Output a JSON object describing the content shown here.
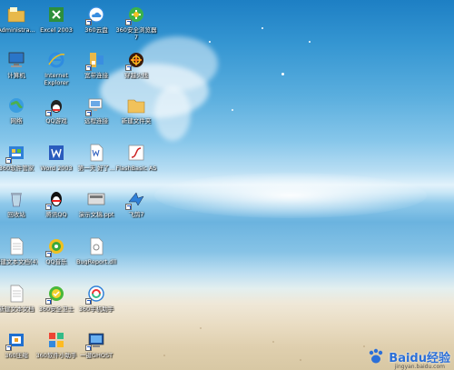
{
  "desktop": {
    "icons": [
      {
        "id": "admin",
        "label": "Administra..."
      },
      {
        "id": "excel",
        "label": "Excel 2003"
      },
      {
        "id": "cloud360",
        "label": "360云盘"
      },
      {
        "id": "browser360",
        "label": "360安全浏览器7"
      },
      {
        "id": "computer",
        "label": "计算机"
      },
      {
        "id": "ie",
        "label": "Internet Explorer"
      },
      {
        "id": "broadband",
        "label": "宽带连接"
      },
      {
        "id": "game",
        "label": "穿越火线"
      },
      {
        "id": "network",
        "label": "网络"
      },
      {
        "id": "qqgame",
        "label": "QQ游戏"
      },
      {
        "id": "remote",
        "label": "远程连接"
      },
      {
        "id": "newfolder",
        "label": "新建文件夹"
      },
      {
        "id": "soft360",
        "label": "360软件管家"
      },
      {
        "id": "word",
        "label": "Word 2003"
      },
      {
        "id": "doc1",
        "label": "第一天 好了..."
      },
      {
        "id": "flash",
        "label": "FlashBasic AS"
      },
      {
        "id": "recycle",
        "label": "回收站"
      },
      {
        "id": "tencentqq",
        "label": "腾讯QQ"
      },
      {
        "id": "ppt",
        "label": "演示文稿.ppt"
      },
      {
        "id": "feiq",
        "label": "飞鸽7"
      },
      {
        "id": "txt1",
        "label": "新建文本文档(4)"
      },
      {
        "id": "qqmusic",
        "label": "QQ音乐"
      },
      {
        "id": "bugreport",
        "label": "BugReport.dll"
      },
      {
        "id": "txt2",
        "label": "新建文本文档"
      },
      {
        "id": "guard360",
        "label": "360安全卫士"
      },
      {
        "id": "phone360",
        "label": "360手机助手"
      },
      {
        "id": "pdf360",
        "label": "360压缩"
      },
      {
        "id": "box360",
        "label": "360软件小助手"
      },
      {
        "id": "mycomputer2",
        "label": "一键GHOST"
      }
    ]
  },
  "watermark": {
    "text": "Baidu经验",
    "sub": "jingyan.baidu.com"
  }
}
